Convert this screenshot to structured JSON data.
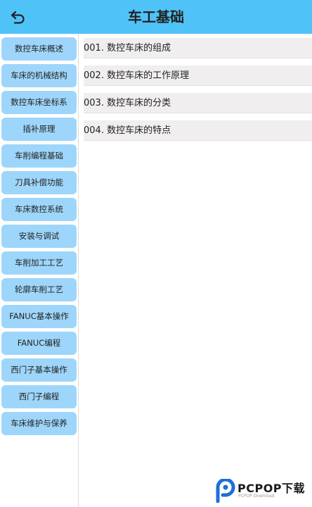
{
  "header": {
    "title": "车工基础",
    "back_icon": "back-arrow-icon"
  },
  "sidebar": {
    "items": [
      {
        "label": "数控车床概述"
      },
      {
        "label": "车床的机械结构"
      },
      {
        "label": "数控车床坐标系"
      },
      {
        "label": "插补原理"
      },
      {
        "label": "车削编程基础"
      },
      {
        "label": "刀具补偿功能"
      },
      {
        "label": "车床数控系统"
      },
      {
        "label": "安装与调试"
      },
      {
        "label": "车削加工工艺"
      },
      {
        "label": "轮廓车削工艺"
      },
      {
        "label": "FANUC基本操作"
      },
      {
        "label": "FANUC编程"
      },
      {
        "label": "西门子基本操作"
      },
      {
        "label": "西门子编程"
      },
      {
        "label": "车床维护与保养"
      }
    ]
  },
  "content": {
    "items": [
      {
        "label": "001. 数控车床的组成"
      },
      {
        "label": "002. 数控车床的工作原理"
      },
      {
        "label": "003. 数控车床的分类"
      },
      {
        "label": "004. 数控车床的特点"
      }
    ]
  },
  "watermark": {
    "brand": "PCPOP下载",
    "sub": "PCPOP Download"
  },
  "colors": {
    "header_bg": "#4fc3f7",
    "sidebar_item_bg": "#9ed6fb",
    "list_item_bg": "#f0eeee",
    "watermark_blue": "#1e6fd9"
  }
}
